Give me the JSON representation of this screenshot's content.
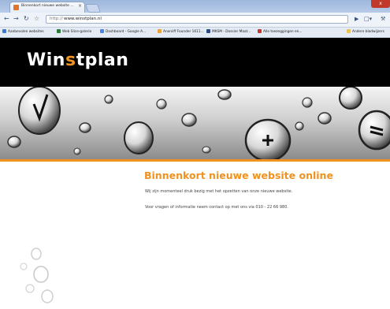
{
  "browser": {
    "tab_title": "Binnenkort nieuwe website ...",
    "tab_close": "×",
    "url_scheme": "http://",
    "url_host": "www.winstplan.nl",
    "window_close": "x",
    "bookmarks": [
      {
        "label": "Aanbevolen websites",
        "color": "#3a7bd5"
      },
      {
        "label": "Web Slice-galerie",
        "color": "#2b7a3d"
      },
      {
        "label": "Dashboard - Google A...",
        "color": "#4a86e8"
      },
      {
        "label": "Anoniiff Founder 1611...",
        "color": "#e6a23c"
      },
      {
        "label": "MKSM - Dossier Maat...",
        "color": "#2c4a7a"
      },
      {
        "label": "Alle toezeggingen en...",
        "color": "#c0392b"
      },
      {
        "label": "Andere bladwijzers",
        "color": "#e8c15a"
      }
    ]
  },
  "site": {
    "logo_main": "Win",
    "logo_accent": "s",
    "logo_tail": "tplan",
    "heading": "Binnenkort nieuwe website online",
    "paragraph1": "Wij zijn momenteel druk bezig met het opzetten van onze nieuwe website.",
    "paragraph2": "Voor vragen of informatie neem contact op met ons via 010 - 22 66 980."
  },
  "colors": {
    "accent": "#f0921f",
    "header_bg": "#000000"
  }
}
